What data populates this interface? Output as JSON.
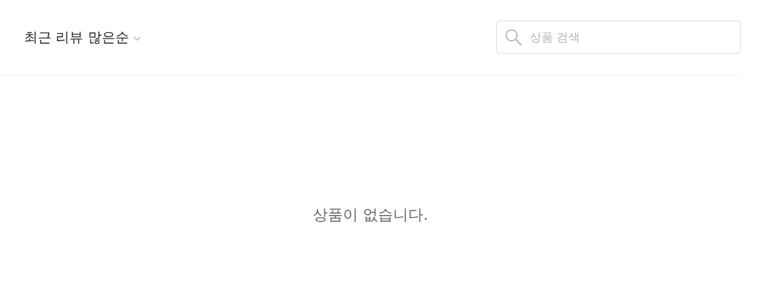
{
  "sort": {
    "label": "최근 리뷰 많은순"
  },
  "search": {
    "placeholder": "상품 검색"
  },
  "empty_message": "상품이 없습니다."
}
